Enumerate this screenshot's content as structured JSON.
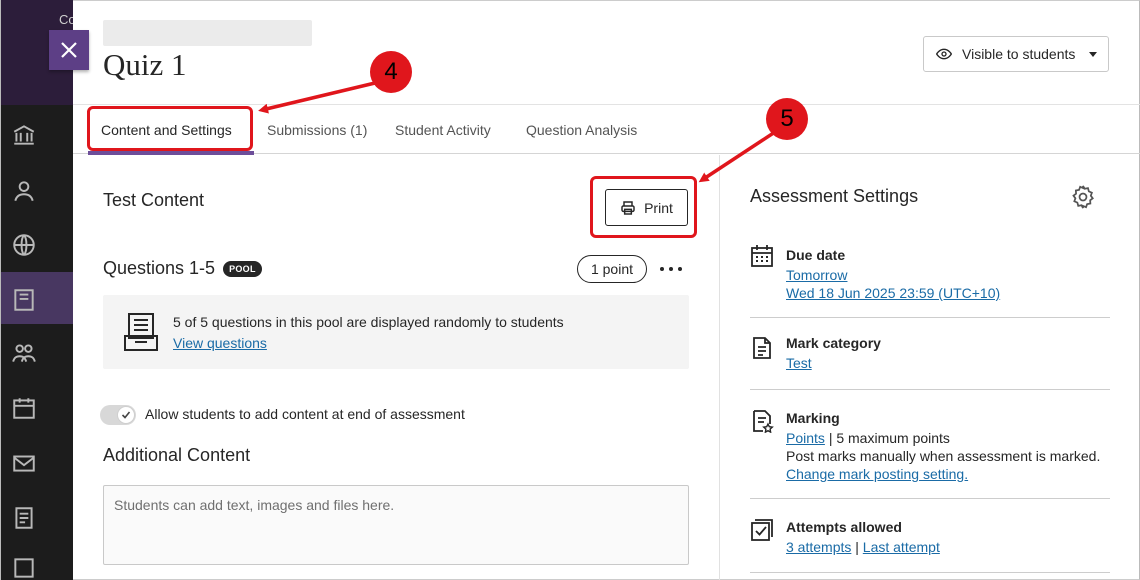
{
  "background": {
    "partial_header_text": "Co"
  },
  "panel": {
    "page_title": "Quiz 1",
    "visibility": {
      "label": "Visible to students"
    }
  },
  "tabs": [
    {
      "label": "Content and Settings",
      "active": true
    },
    {
      "label": "Submissions (1)",
      "active": false
    },
    {
      "label": "Student Activity",
      "active": false
    },
    {
      "label": "Question Analysis",
      "active": false
    }
  ],
  "test_content": {
    "title": "Test Content",
    "print_label": "Print",
    "questions_title": "Questions 1-5",
    "pool_badge": "POOL",
    "points": "1 point",
    "pool_text": "5 of 5 questions in this pool are displayed randomly to students",
    "pool_link": "View questions",
    "toggle_label": "Allow students to add content at end of assessment",
    "additional_title": "Additional Content",
    "additional_placeholder": "Students can add text, images and files here."
  },
  "assessment_settings": {
    "title": "Assessment Settings",
    "due_date": {
      "label": "Due date",
      "link1": "Tomorrow",
      "link2": "Wed 18 Jun 2025 23:59 (UTC+10)"
    },
    "mark_category": {
      "label": "Mark category",
      "link": "Test"
    },
    "marking": {
      "label": "Marking",
      "link": "Points",
      "separator": "|",
      "points_text": "5 maximum points",
      "post_text": "Post marks manually when assessment is marked.",
      "post_link": "Change mark posting setting."
    },
    "attempts": {
      "label": "Attempts allowed",
      "link1": "3 attempts",
      "separator": "|",
      "link2": "Last attempt"
    }
  },
  "annotations": {
    "step4": "4",
    "step5": "5",
    "color": "#e0161c"
  },
  "colors": {
    "accent": "#6d4e9a",
    "close_button": "#5d3f86",
    "link": "#1a6ba6"
  }
}
